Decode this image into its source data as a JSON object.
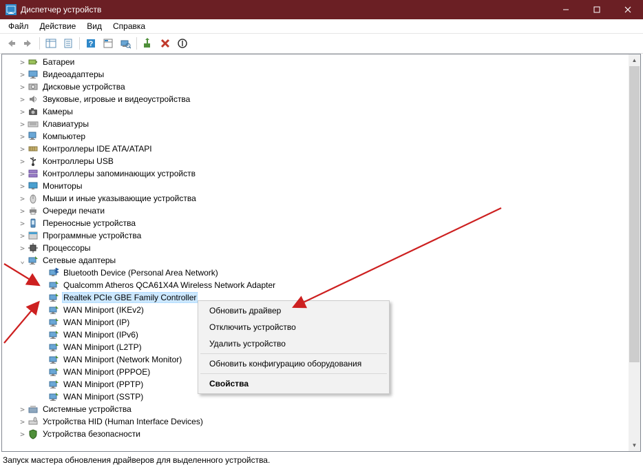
{
  "window": {
    "title": "Диспетчер устройств"
  },
  "menu": {
    "items": [
      "Файл",
      "Действие",
      "Вид",
      "Справка"
    ]
  },
  "categories": [
    {
      "label": "Батареи",
      "icon": "battery"
    },
    {
      "label": "Видеоадаптеры",
      "icon": "display"
    },
    {
      "label": "Дисковые устройства",
      "icon": "disk"
    },
    {
      "label": "Звуковые, игровые и видеоустройства",
      "icon": "sound"
    },
    {
      "label": "Камеры",
      "icon": "camera"
    },
    {
      "label": "Клавиатуры",
      "icon": "keyboard"
    },
    {
      "label": "Компьютер",
      "icon": "computer"
    },
    {
      "label": "Контроллеры IDE ATA/ATAPI",
      "icon": "ide"
    },
    {
      "label": "Контроллеры USB",
      "icon": "usb"
    },
    {
      "label": "Контроллеры запоминающих устройств",
      "icon": "storage"
    },
    {
      "label": "Мониторы",
      "icon": "monitor"
    },
    {
      "label": "Мыши и иные указывающие устройства",
      "icon": "mouse"
    },
    {
      "label": "Очереди печати",
      "icon": "printer"
    },
    {
      "label": "Переносные устройства",
      "icon": "portable"
    },
    {
      "label": "Программные устройства",
      "icon": "software"
    },
    {
      "label": "Процессоры",
      "icon": "cpu"
    }
  ],
  "netcat": {
    "label": "Сетевые адаптеры"
  },
  "netdevices": [
    {
      "label": "Bluetooth Device (Personal Area Network)",
      "icon": "bt"
    },
    {
      "label": "Qualcomm Atheros QCA61X4A Wireless Network Adapter",
      "icon": "net"
    },
    {
      "label": "Realtek PCIe GBE Family Controller",
      "icon": "net",
      "selected": true
    },
    {
      "label": "WAN Miniport (IKEv2)",
      "icon": "net"
    },
    {
      "label": "WAN Miniport (IP)",
      "icon": "net"
    },
    {
      "label": "WAN Miniport (IPv6)",
      "icon": "net"
    },
    {
      "label": "WAN Miniport (L2TP)",
      "icon": "net"
    },
    {
      "label": "WAN Miniport (Network Monitor)",
      "icon": "net"
    },
    {
      "label": "WAN Miniport (PPPOE)",
      "icon": "net"
    },
    {
      "label": "WAN Miniport (PPTP)",
      "icon": "net"
    },
    {
      "label": "WAN Miniport (SSTP)",
      "icon": "net"
    }
  ],
  "tail": [
    {
      "label": "Системные устройства",
      "icon": "system"
    },
    {
      "label": "Устройства HID (Human Interface Devices)",
      "icon": "hid"
    },
    {
      "label": "Устройства безопасности",
      "icon": "security"
    }
  ],
  "context": {
    "items": [
      "Обновить драйвер",
      "Отключить устройство",
      "Удалить устройство",
      "Обновить конфигурацию оборудования",
      "Свойства"
    ]
  },
  "status": "Запуск мастера обновления драйверов для выделенного устройства."
}
